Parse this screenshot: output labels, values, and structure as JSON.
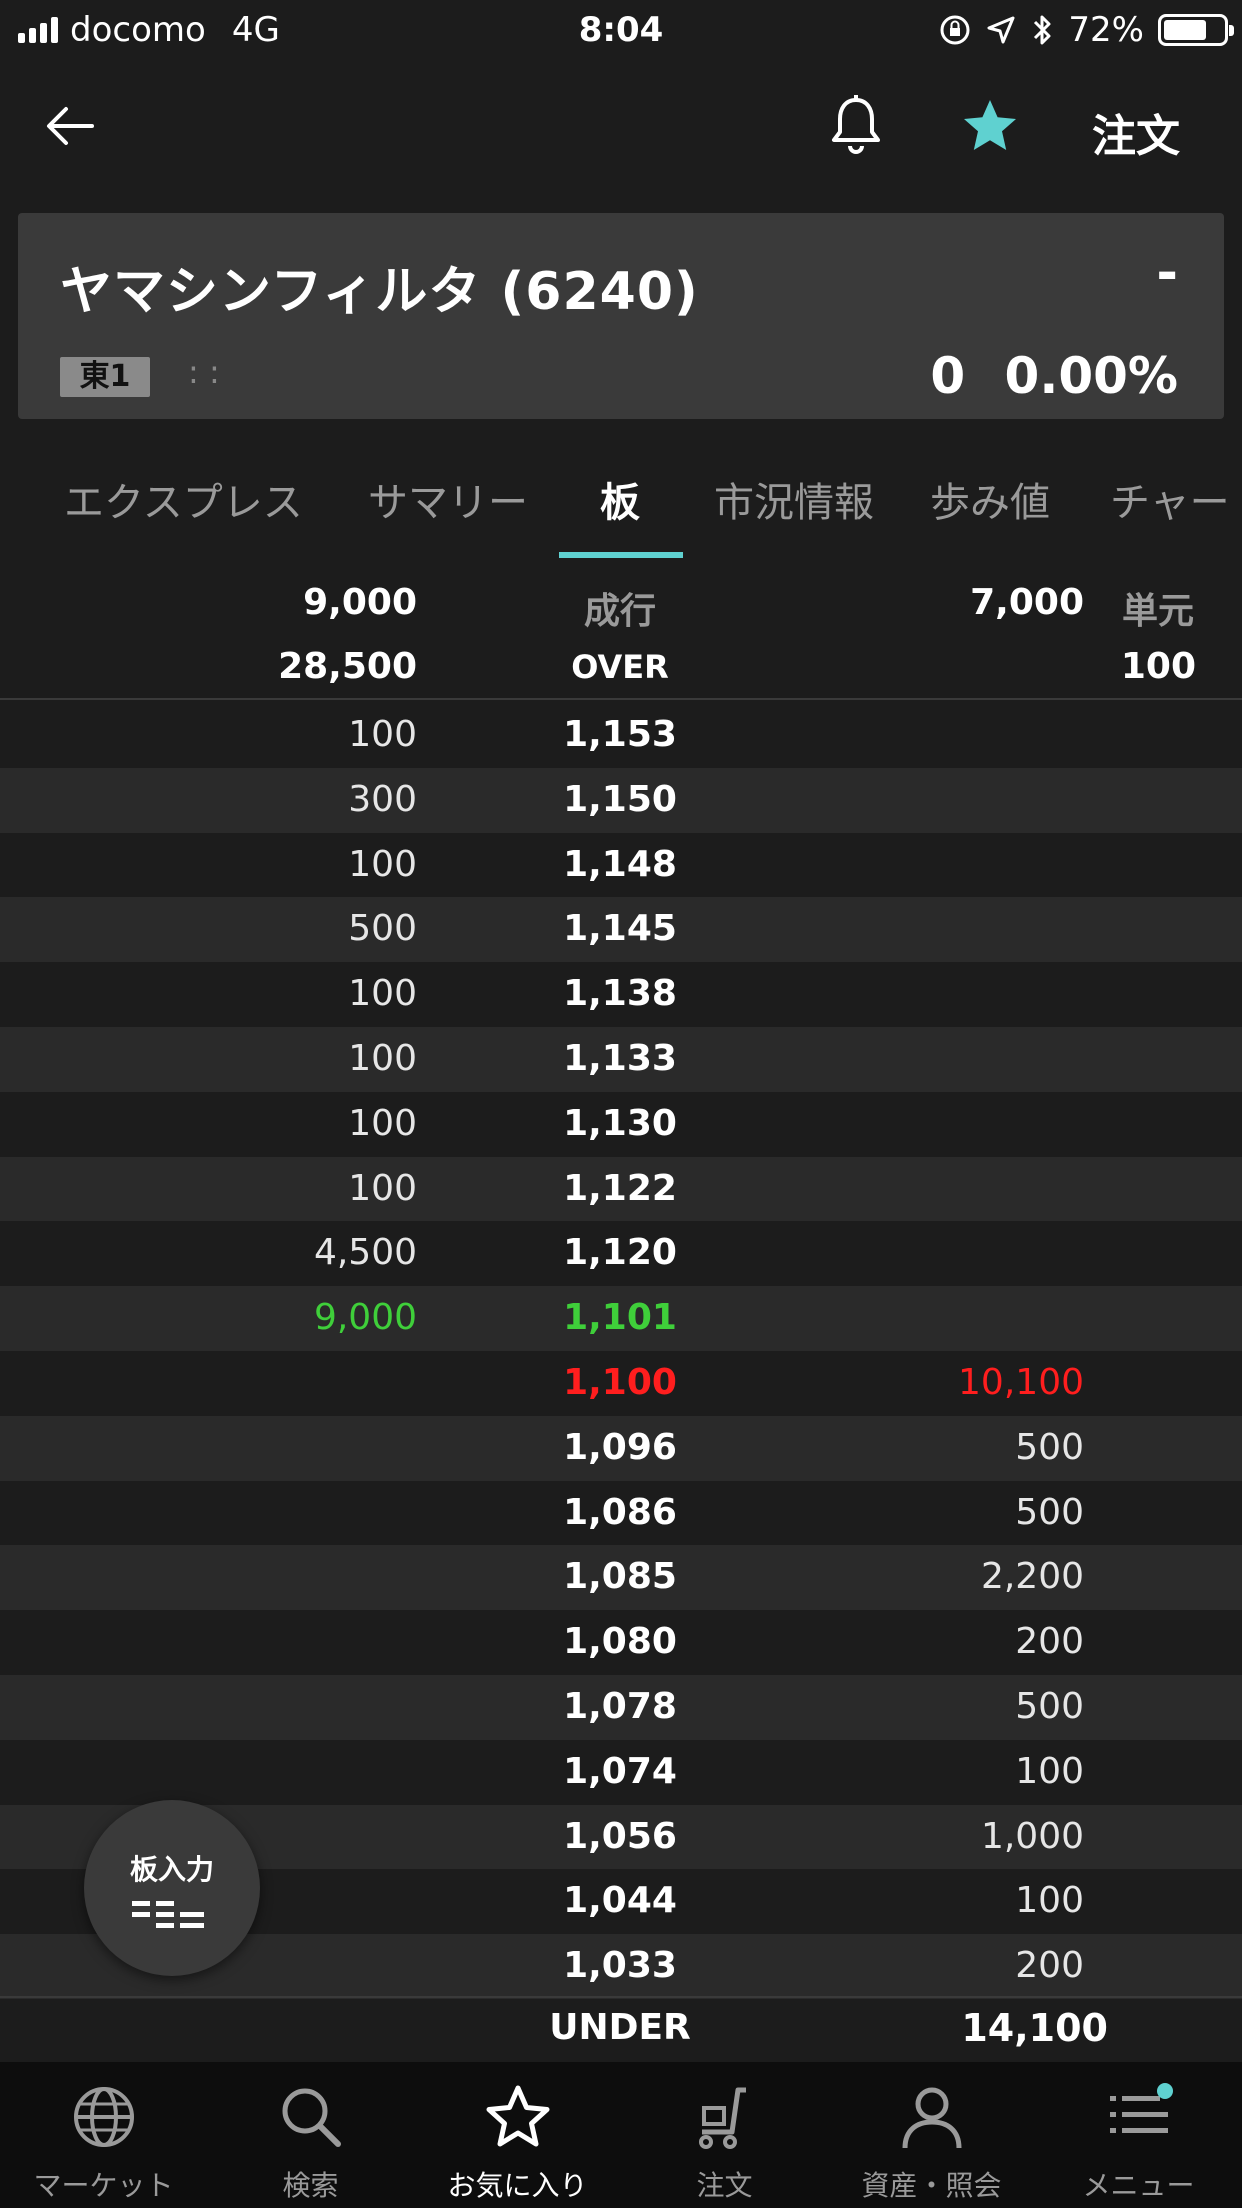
{
  "status_bar": {
    "carrier": "docomo",
    "network": "4G",
    "time": "8:04",
    "battery": "72%",
    "battery_level": 0.72
  },
  "nav": {
    "back_icon": "arrow-left-icon",
    "bell_icon": "bell-icon",
    "star_icon": "star-icon",
    "order_label": "注文",
    "accent_color": "#5fd1d0"
  },
  "stock": {
    "name": "ヤマシンフィルタ (6240)",
    "price": "-",
    "market": "東1",
    "time": ": :",
    "change": "0",
    "change_pct": "0.00%"
  },
  "tabs": [
    {
      "label": "エクスプレス",
      "active": false
    },
    {
      "label": "サマリー",
      "active": false
    },
    {
      "label": "板",
      "active": true
    },
    {
      "label": "市況情報",
      "active": false
    },
    {
      "label": "歩み値",
      "active": false
    },
    {
      "label": "チャー",
      "active": false
    }
  ],
  "board": {
    "header": {
      "sell_market": "9,000",
      "market_label": "成行",
      "buy_market": "7,000",
      "unit_label": "単元",
      "over_qty": "28,500",
      "over_label": "OVER",
      "unit_value": "100"
    },
    "rows": [
      {
        "sell": "100",
        "price": "1,153",
        "buy": ""
      },
      {
        "sell": "300",
        "price": "1,150",
        "buy": ""
      },
      {
        "sell": "100",
        "price": "1,148",
        "buy": ""
      },
      {
        "sell": "500",
        "price": "1,145",
        "buy": ""
      },
      {
        "sell": "100",
        "price": "1,138",
        "buy": ""
      },
      {
        "sell": "100",
        "price": "1,133",
        "buy": ""
      },
      {
        "sell": "100",
        "price": "1,130",
        "buy": ""
      },
      {
        "sell": "100",
        "price": "1,122",
        "buy": ""
      },
      {
        "sell": "4,500",
        "price": "1,120",
        "buy": ""
      },
      {
        "sell": "9,000",
        "price": "1,101",
        "buy": "",
        "highlight": "green"
      },
      {
        "sell": "",
        "price": "1,100",
        "buy": "10,100",
        "highlight": "red"
      },
      {
        "sell": "",
        "price": "1,096",
        "buy": "500"
      },
      {
        "sell": "",
        "price": "1,086",
        "buy": "500"
      },
      {
        "sell": "",
        "price": "1,085",
        "buy": "2,200"
      },
      {
        "sell": "",
        "price": "1,080",
        "buy": "200"
      },
      {
        "sell": "",
        "price": "1,078",
        "buy": "500"
      },
      {
        "sell": "",
        "price": "1,074",
        "buy": "100"
      },
      {
        "sell": "",
        "price": "1,056",
        "buy": "1,000"
      },
      {
        "sell": "",
        "price": "1,044",
        "buy": "100"
      },
      {
        "sell": "",
        "price": "1,033",
        "buy": "200"
      }
    ],
    "under_label": "UNDER",
    "under_qty": "14,100",
    "colors": {
      "green": "#3fcf3a",
      "red": "#ff1e1e"
    }
  },
  "fab": {
    "label": "板入力",
    "icon": "board-input-icon"
  },
  "tabbar": [
    {
      "label": "マーケット",
      "icon": "globe-icon",
      "active": false
    },
    {
      "label": "検索",
      "icon": "search-icon",
      "active": false
    },
    {
      "label": "お気に入り",
      "icon": "star-outline-icon",
      "active": true
    },
    {
      "label": "注文",
      "icon": "cart-icon",
      "active": false
    },
    {
      "label": "資産・照会",
      "icon": "person-icon",
      "active": false
    },
    {
      "label": "メニュー",
      "icon": "menu-list-icon",
      "active": false
    }
  ]
}
